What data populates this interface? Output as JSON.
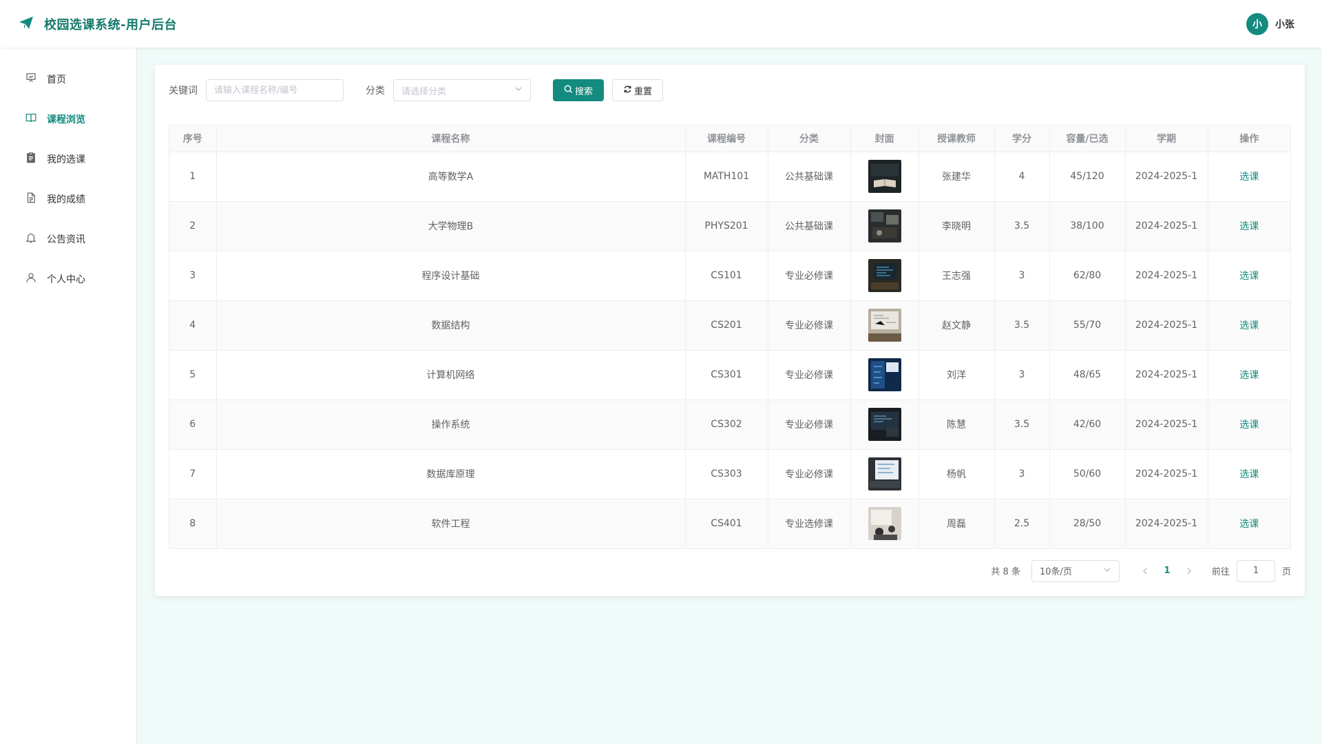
{
  "header": {
    "title": "校园选课系统-用户后台",
    "avatar_text": "小",
    "username": "小张"
  },
  "sidebar": {
    "items": [
      {
        "label": "首页",
        "icon": "presentation-icon"
      },
      {
        "label": "课程浏览",
        "icon": "book-icon",
        "active": true
      },
      {
        "label": "我的选课",
        "icon": "clipboard-icon"
      },
      {
        "label": "我的成绩",
        "icon": "document-icon"
      },
      {
        "label": "公告资讯",
        "icon": "bell-icon"
      },
      {
        "label": "个人中心",
        "icon": "user-icon"
      }
    ]
  },
  "search": {
    "keyword_label": "关键词",
    "keyword_placeholder": "请输入课程名称/编号",
    "category_label": "分类",
    "category_placeholder": "请选择分类",
    "search_button": "搜索",
    "reset_button": "重置"
  },
  "table": {
    "columns": [
      "序号",
      "课程名称",
      "课程编号",
      "分类",
      "封面",
      "授课教师",
      "学分",
      "容量/已选",
      "学期",
      "操作"
    ],
    "rows": [
      {
        "no": "1",
        "name": "高等数学A",
        "code": "MATH101",
        "category": "公共基础课",
        "teacher": "张建华",
        "credit": "4",
        "capacity": "45/120",
        "term": "2024-2025-1",
        "action": "选课"
      },
      {
        "no": "2",
        "name": "大学物理B",
        "code": "PHYS201",
        "category": "公共基础课",
        "teacher": "李晓明",
        "credit": "3.5",
        "capacity": "38/100",
        "term": "2024-2025-1",
        "action": "选课"
      },
      {
        "no": "3",
        "name": "程序设计基础",
        "code": "CS101",
        "category": "专业必修课",
        "teacher": "王志强",
        "credit": "3",
        "capacity": "62/80",
        "term": "2024-2025-1",
        "action": "选课"
      },
      {
        "no": "4",
        "name": "数据结构",
        "code": "CS201",
        "category": "专业必修课",
        "teacher": "赵文静",
        "credit": "3.5",
        "capacity": "55/70",
        "term": "2024-2025-1",
        "action": "选课"
      },
      {
        "no": "5",
        "name": "计算机网络",
        "code": "CS301",
        "category": "专业必修课",
        "teacher": "刘洋",
        "credit": "3",
        "capacity": "48/65",
        "term": "2024-2025-1",
        "action": "选课"
      },
      {
        "no": "6",
        "name": "操作系统",
        "code": "CS302",
        "category": "专业必修课",
        "teacher": "陈慧",
        "credit": "3.5",
        "capacity": "42/60",
        "term": "2024-2025-1",
        "action": "选课"
      },
      {
        "no": "7",
        "name": "数据库原理",
        "code": "CS303",
        "category": "专业必修课",
        "teacher": "杨帆",
        "credit": "3",
        "capacity": "50/60",
        "term": "2024-2025-1",
        "action": "选课"
      },
      {
        "no": "8",
        "name": "软件工程",
        "code": "CS401",
        "category": "专业选修课",
        "teacher": "周磊",
        "credit": "2.5",
        "capacity": "28/50",
        "term": "2024-2025-1",
        "action": "选课"
      }
    ]
  },
  "pagination": {
    "total": "共 8 条",
    "page_size": "10条/页",
    "current_page": "1",
    "goto_label": "前往",
    "goto_value": "1",
    "goto_suffix": "页"
  },
  "colors": {
    "accent": "#138b7e",
    "background": "#f0faf8"
  }
}
